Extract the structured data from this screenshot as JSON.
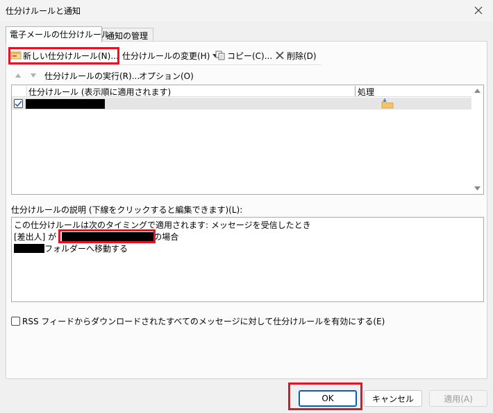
{
  "window": {
    "title": "仕分けルールと通知"
  },
  "tabs": [
    {
      "label": "電子メールの仕分けルール"
    },
    {
      "label": "通知の管理"
    }
  ],
  "toolbar": {
    "new_rule": "新しい仕分けルール(N)...",
    "change_rule": "仕分けルールの変更(H)",
    "copy": "コピー(C)...",
    "delete": "削除(D)",
    "run_rules": "仕分けルールの実行(R)...",
    "options": "オプション(O)"
  },
  "rules_list": {
    "columns": [
      "仕分けルール (表示順に適用されます)",
      "処理"
    ],
    "rows": [
      {
        "checked": true,
        "name_redacted": true,
        "action_icon": "move-to-folder-icon"
      }
    ]
  },
  "description": {
    "label": "仕分けルールの説明 (下線をクリックすると編集できます)(L):",
    "line1": "この仕分けルールは次のタイミングで適用されます: メッセージを受信したとき",
    "line2_prefix": "[差出人] が",
    "line2_suffix": "の場合",
    "line3_suffix": "フォルダーへ移動する"
  },
  "rss": {
    "label": "RSS フィードからダウンロードされたすべてのメッセージに対して仕分けルールを有効にする(E)",
    "checked": false
  },
  "buttons": {
    "ok": "OK",
    "cancel": "キャンセル",
    "apply": "適用(A)"
  },
  "colors": {
    "highlight_box": "#e81123",
    "primary_button_border": "#005fb8",
    "selected_row": "#e5e5e5"
  }
}
